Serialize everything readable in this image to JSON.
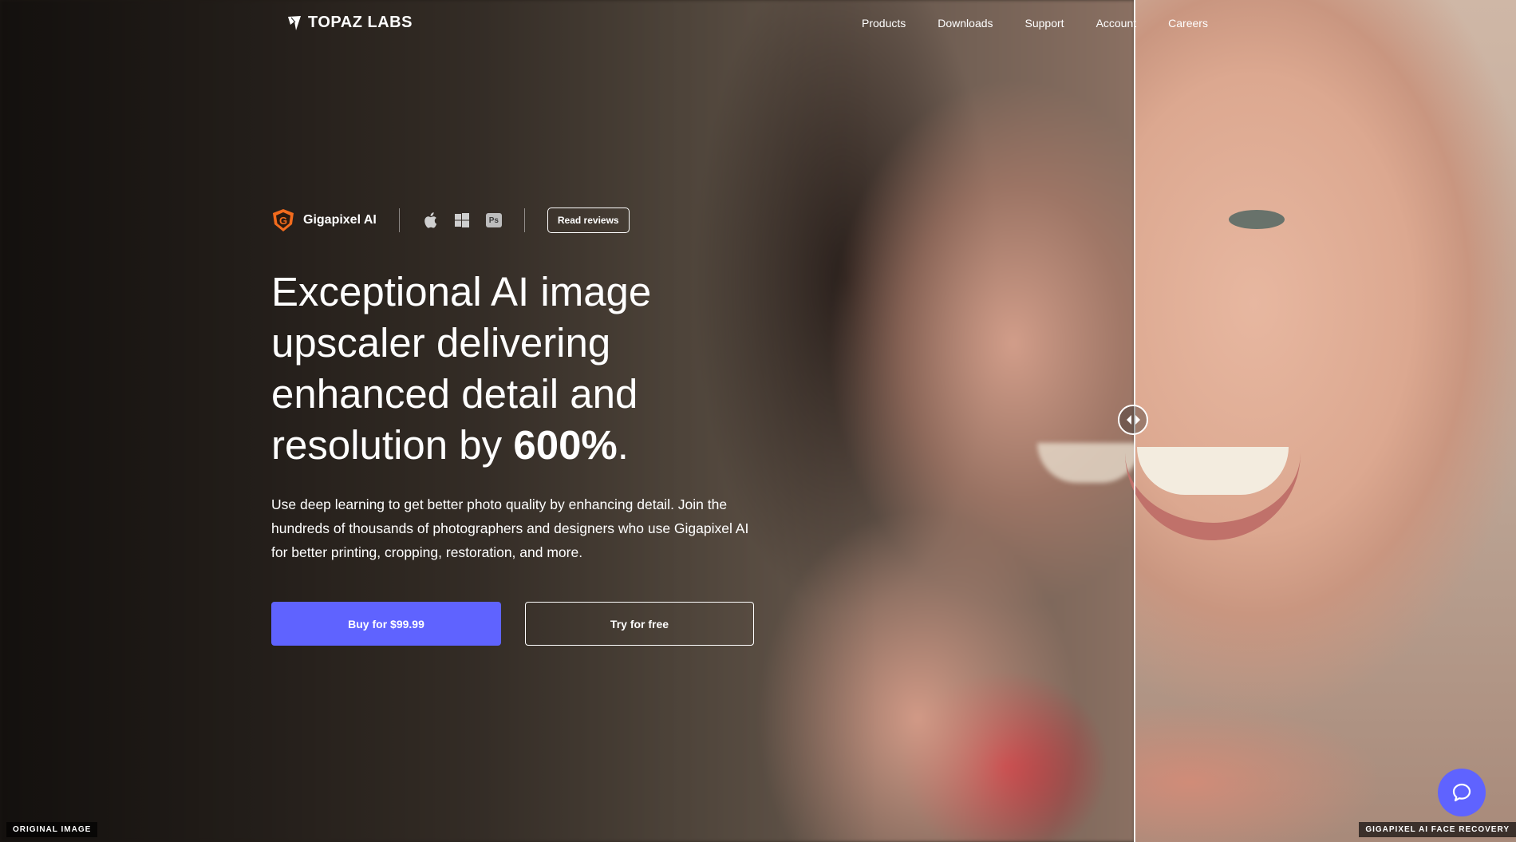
{
  "brand": {
    "name": "TOPAZ LABS",
    "logo_icon": "topaz-logo-icon"
  },
  "nav": {
    "items": [
      {
        "label": "Products"
      },
      {
        "label": "Downloads"
      },
      {
        "label": "Support"
      },
      {
        "label": "Account"
      },
      {
        "label": "Careers"
      }
    ]
  },
  "product": {
    "name": "Gigapixel AI",
    "badge_letter": "G",
    "badge_color": "#f26b1d",
    "platforms": [
      "apple-icon",
      "windows-icon",
      "photoshop-icon"
    ],
    "ps_label": "Ps",
    "reviews_label": "Read reviews"
  },
  "hero": {
    "headline_main": "Exceptional AI image upscaler delivering enhanced detail and resolution by",
    "headline_emphasis": "600%",
    "headline_end": ".",
    "subcopy": "Use deep learning to get better photo quality by enhancing detail. Join the hundreds of thousands of photographers and designers who use Gigapixel AI for better printing, cropping, restoration, and more.",
    "buy_label": "Buy for $99.99",
    "try_label": "Try for free",
    "accent_color": "#5f63ff"
  },
  "comparison": {
    "left_label": "ORIGINAL IMAGE",
    "right_label": "GIGAPIXEL AI FACE RECOVERY",
    "handle_icon": "drag-handle-icon"
  },
  "chat": {
    "icon": "chat-bubble-icon"
  }
}
